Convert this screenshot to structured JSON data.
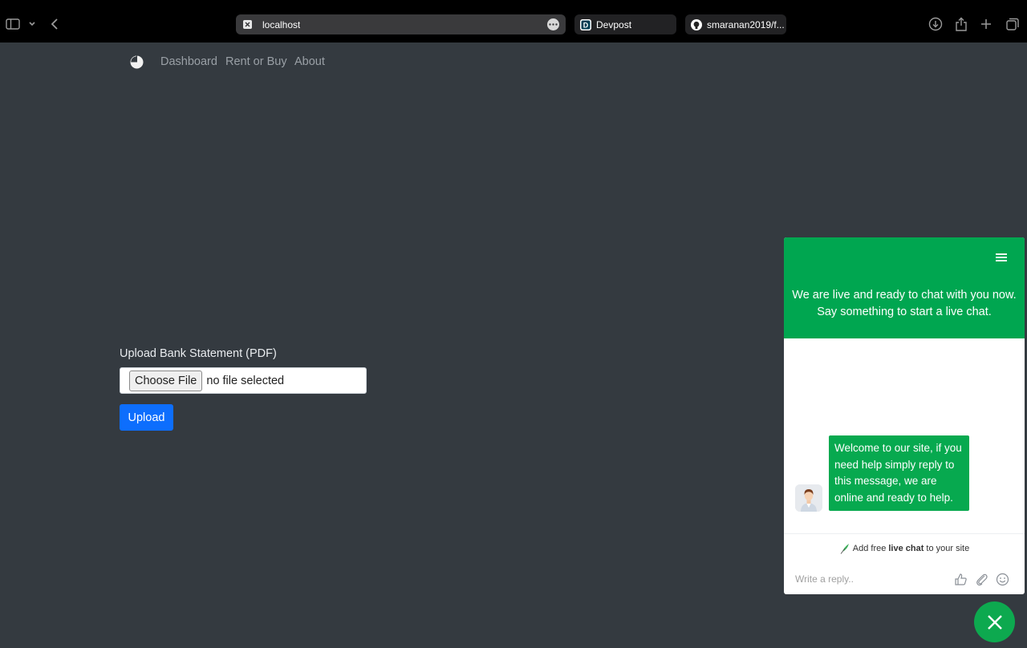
{
  "browser": {
    "active_tab": {
      "title": "localhost",
      "favicon": "close-square-icon"
    },
    "tabs": [
      {
        "title": "Devpost",
        "favicon": "devpost-icon"
      },
      {
        "title": "smaranan2019/f...",
        "favicon": "github-icon"
      }
    ]
  },
  "nav": {
    "logo": "pie-chart-logo",
    "links": [
      {
        "label": "Dashboard"
      },
      {
        "label": "Rent or Buy"
      },
      {
        "label": "About"
      }
    ]
  },
  "upload": {
    "label": "Upload Bank Statement (PDF)",
    "choose_button": "Choose File",
    "file_status": "no file selected",
    "submit_label": "Upload"
  },
  "chat": {
    "header_line1": "We are live and ready to chat with you now.",
    "header_line2": "Say something to start a live chat.",
    "welcome_message": "Welcome to our site, if you need help simply reply to this message, we are online and ready to help.",
    "promo_prefix": "Add free",
    "promo_bold": "live chat",
    "promo_suffix": "to your site",
    "reply_placeholder": "Write a reply..",
    "accent_color": "#00a650"
  },
  "colors": {
    "page_background": "#343a40",
    "primary_button": "#0d6efd"
  }
}
